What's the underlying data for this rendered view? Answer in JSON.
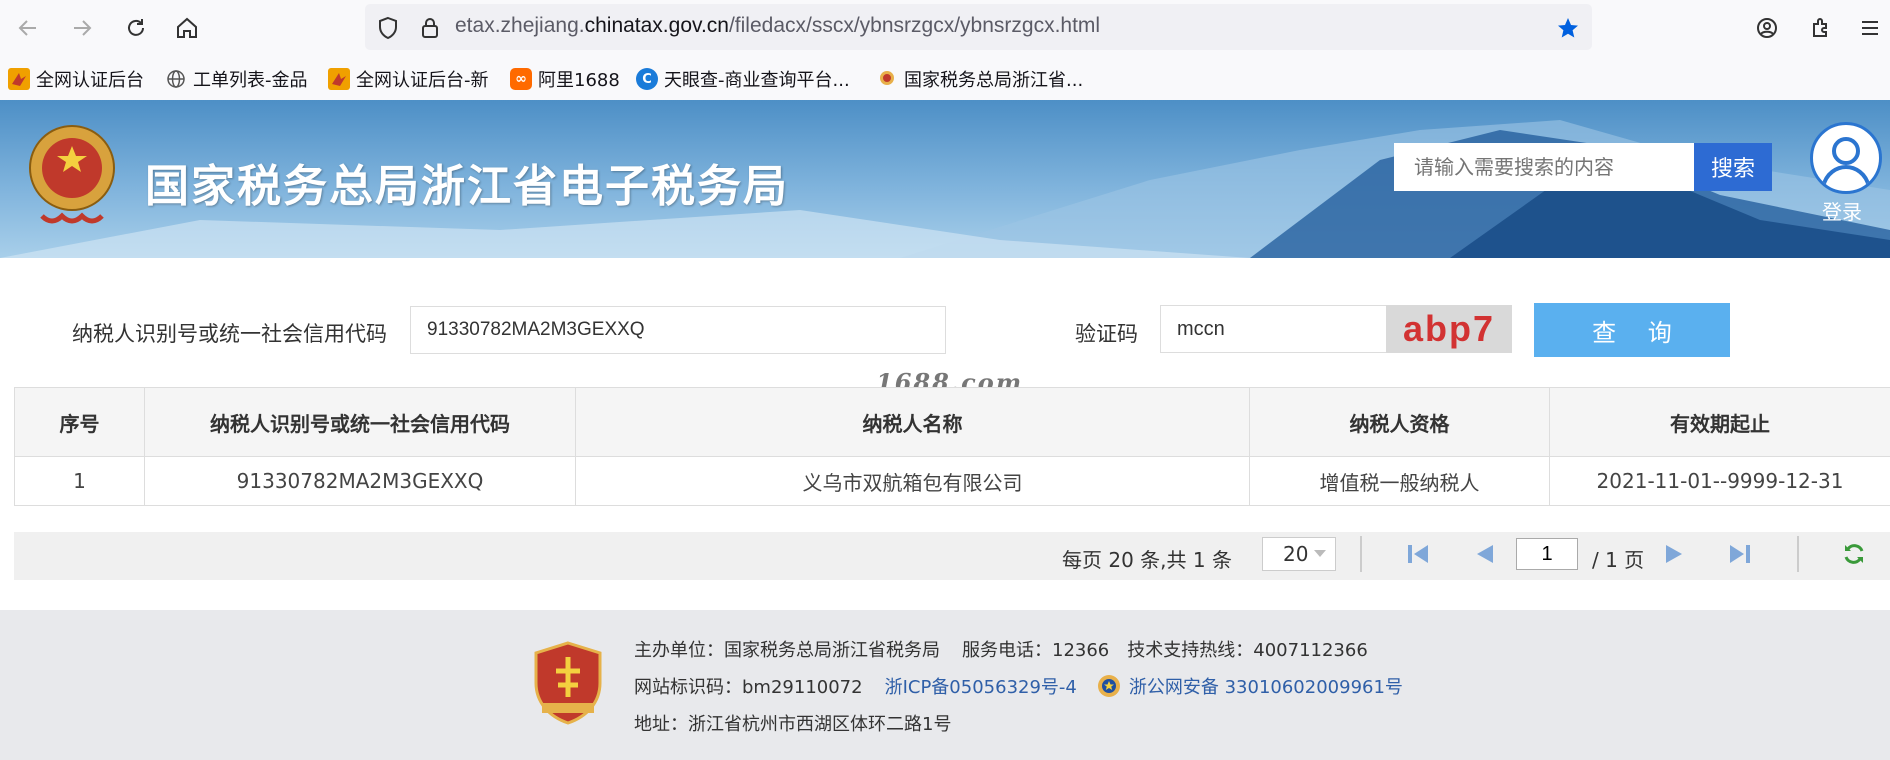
{
  "browser": {
    "url_prefix": "etax.zhejiang.",
    "url_domain": "chinatax.gov.cn",
    "url_path": "/filedacx/sscx/ybnsrzgcx/ybnsrzgcx.html",
    "bookmarks": [
      {
        "label": "全网认证后台",
        "icon": "bookmark-logo-icon",
        "color": "#f0a000"
      },
      {
        "label": "工单列表-金品",
        "icon": "globe-icon",
        "color": "#555555"
      },
      {
        "label": "全网认证后台-新",
        "icon": "bookmark-logo-icon",
        "color": "#f0a000"
      },
      {
        "label": "阿里1688",
        "icon": "alibaba-icon",
        "color": "#ff6a00"
      },
      {
        "label": "天眼查-商业查询平台...",
        "icon": "tianyancha-icon",
        "color": "#1a7bd9"
      },
      {
        "label": "国家税务总局浙江省...",
        "icon": "tax-emblem-icon",
        "color": "#c0392b"
      }
    ]
  },
  "header": {
    "title": "国家税务总局浙江省电子税务局",
    "search_placeholder": "请输入需要搜索的内容",
    "search_label": "搜索",
    "login_label": "登录"
  },
  "form": {
    "taxid_label": "纳税人识别号或统一社会信用代码",
    "taxid_value": "91330782MA2M3GEXXQ",
    "code_label": "验证码",
    "code_value": "mccn",
    "captcha_text": "abp7",
    "query_label": "查 询"
  },
  "watermark": "1688.com",
  "table": {
    "headers": [
      "序号",
      "纳税人识别号或统一社会信用代码",
      "纳税人名称",
      "纳税人资格",
      "有效期起止"
    ],
    "rows": [
      [
        "1",
        "91330782MA2M3GEXXQ",
        "义乌市双航箱包有限公司",
        "增值税一般纳税人",
        "2021-11-01--9999-12-31"
      ]
    ]
  },
  "pager": {
    "info": "每页 20 条,共 1 条",
    "page_size": "20",
    "current_page": "1",
    "total_pages": "/ 1 页"
  },
  "footer": {
    "sponsor": "主办单位：国家税务总局浙江省税务局",
    "hotline": "服务电话：12366",
    "support": "技术支持热线：4007112366",
    "site_code": "网站标识码：bm29110072",
    "icp": "浙ICP备05056329号-4",
    "police": "浙公网安备 33010602009961号",
    "address": "地址：浙江省杭州市西湖区体环二路1号"
  }
}
